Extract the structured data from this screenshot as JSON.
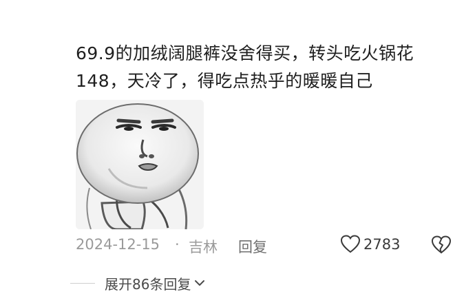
{
  "comment": {
    "text": "69.9的加绒阔腿裤没舍得买，转头吃火锅花\n148，天冷了，得吃点热乎的暖暖自己"
  },
  "sticker": {
    "icon": "meme-face-sticker"
  },
  "meta": {
    "date": "2024-12-15",
    "separator": "·",
    "location": "吉林",
    "reply_label": "回复"
  },
  "actions": {
    "like_icon": "heart-icon",
    "like_count": "2783",
    "dislike_icon": "broken-heart-icon"
  },
  "expand": {
    "label": "展开86条回复",
    "icon": "chevron-down-icon"
  },
  "colors": {
    "text": "#1f1f1f",
    "meta": "#9a9a9a",
    "background": "#ffffff"
  }
}
